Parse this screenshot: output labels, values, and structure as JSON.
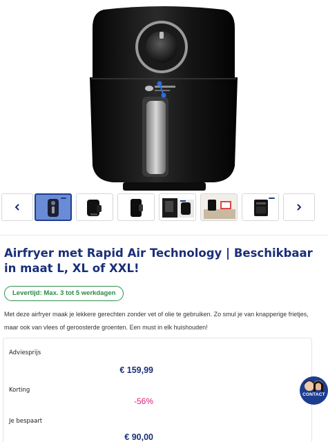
{
  "gallery": {
    "prev_icon": "chevron-left-icon",
    "next_icon": "chevron-right-icon",
    "thumbnails": [
      {
        "name": "thumb-airfryer-blue",
        "active": true
      },
      {
        "name": "thumb-airfryer-black-side",
        "active": false
      },
      {
        "name": "thumb-airfryer-black-profile",
        "active": false
      },
      {
        "name": "thumb-airfryer-box",
        "active": false
      },
      {
        "name": "thumb-airfryer-kitchen",
        "active": false
      },
      {
        "name": "thumb-airfryer-xxl",
        "active": false
      }
    ]
  },
  "product": {
    "title": "Airfryer met Rapid Air Technology | Beschikbaar in maat L, XL of XXL!",
    "delivery_badge": "Levertijd: Max. 3 tot 5 werkdagen",
    "description": "Met deze airfryer maak je lekkere gerechten zonder vet of olie te gebruiken. Zo smul je van knapperige frietjes, maar ook van vlees of geroosterde groenten. Een must in elk huishouden!"
  },
  "pricing": {
    "advice_label": "Adviesprijs",
    "advice_value": "€ 159,99",
    "discount_label": "Korting",
    "discount_value": "-56%",
    "savings_label": "Je bespaart",
    "savings_value": "€ 90,00"
  },
  "contact": {
    "label": "CONTACT"
  },
  "colors": {
    "brand_navy": "#1a2f78",
    "discount_pink": "#d4237c",
    "delivery_green": "#2a8a44"
  }
}
